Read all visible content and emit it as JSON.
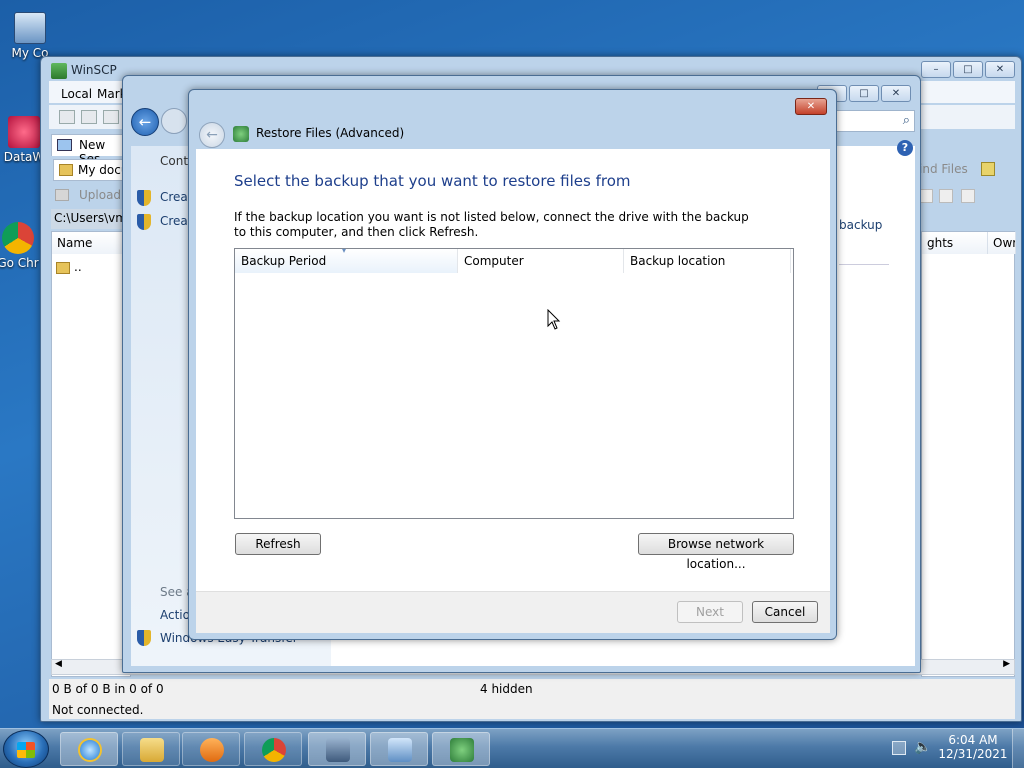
{
  "desktop": {
    "icons": [
      {
        "label": "My Co"
      },
      {
        "label": "DataW"
      },
      {
        "label": "Go Chr"
      }
    ]
  },
  "winscp": {
    "title": "WinSCP",
    "menu": [
      "Local",
      "Mark"
    ],
    "session_tab": "New Ses",
    "location": "My docu",
    "upload_label": "Upload",
    "path": "C:\\Users\\vm1",
    "left_columns": [
      "Name"
    ],
    "up_dir": "..",
    "right_columns": [
      "ghts",
      "Owr"
    ],
    "find_files": "ind Files",
    "status_left": "0 B of 0 B in 0 of 0",
    "status_hidden": "4 hidden",
    "connection_status": "Not connected."
  },
  "control_panel": {
    "left_heading": "Contr",
    "tasks": [
      "Creat",
      "Creat"
    ],
    "see_also": "See a",
    "action": "Actio",
    "easy_transfer": "Windows Easy Transfer",
    "backup_link": "backup"
  },
  "dialog": {
    "title": "Restore Files (Advanced)",
    "heading": "Select the backup that you want to restore files from",
    "instruction": "If the backup location you want is not listed below, connect the drive with the backup to this computer, and then click Refresh.",
    "columns": [
      "Backup Period",
      "Computer",
      "Backup location"
    ],
    "refresh_label": "Refresh",
    "browse_label": "Browse network location...",
    "next_label": "Next",
    "cancel_label": "Cancel"
  },
  "taskbar": {
    "time": "6:04 AM",
    "date": "12/31/2021"
  },
  "colors": {
    "heading_blue": "#1e3f8c",
    "link_blue": "#1c5aa8",
    "desktop_blue": "#2a78c4"
  }
}
